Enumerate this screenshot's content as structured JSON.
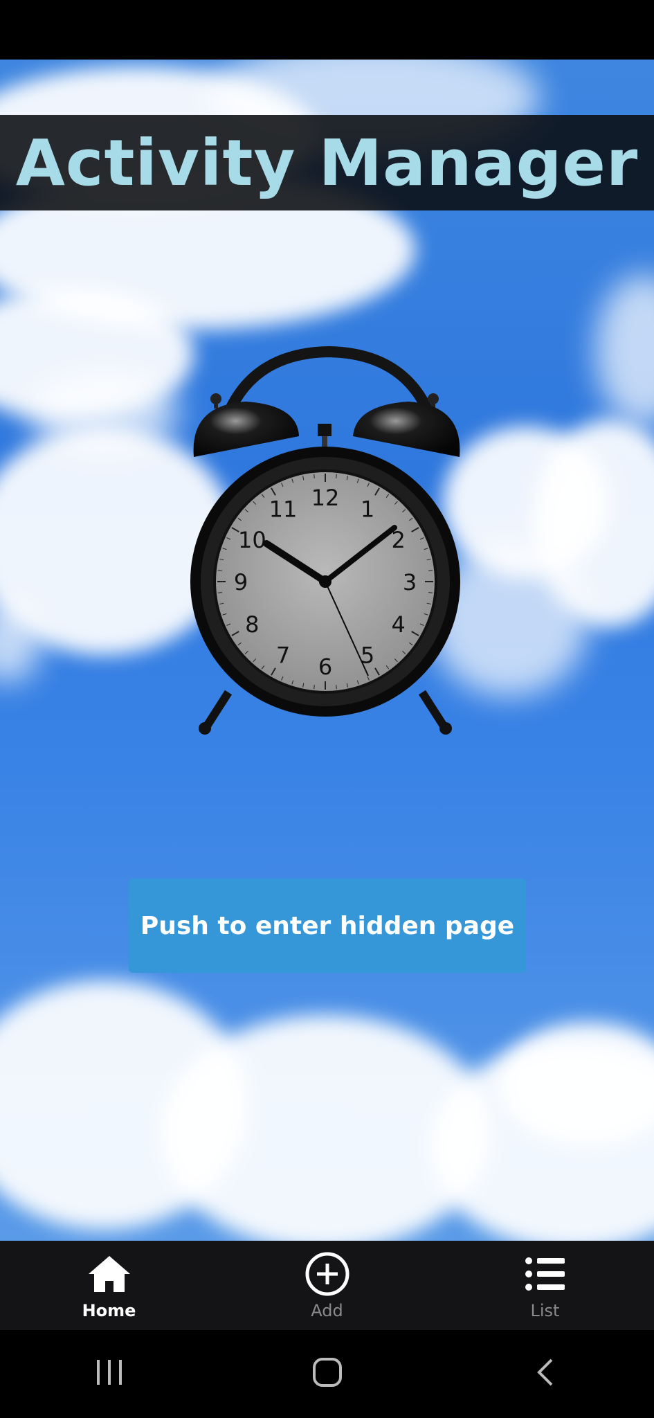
{
  "app": {
    "title": "Activity Manager"
  },
  "clock": {
    "numerals": [
      "12",
      "1",
      "2",
      "3",
      "4",
      "5",
      "6",
      "7",
      "8",
      "9",
      "10",
      "11"
    ]
  },
  "main": {
    "enter_button_label": "Push to enter hidden page"
  },
  "tabs": [
    {
      "label": "Home",
      "icon": "home-icon",
      "active": true
    },
    {
      "label": "Add",
      "icon": "add-circle-icon",
      "active": false
    },
    {
      "label": "List",
      "icon": "list-icon",
      "active": false
    }
  ],
  "colors": {
    "title": "#a8dbe8",
    "button": "#3596d8",
    "tab_bar": "#141416"
  },
  "system_nav": [
    "recent-apps",
    "home",
    "back"
  ]
}
